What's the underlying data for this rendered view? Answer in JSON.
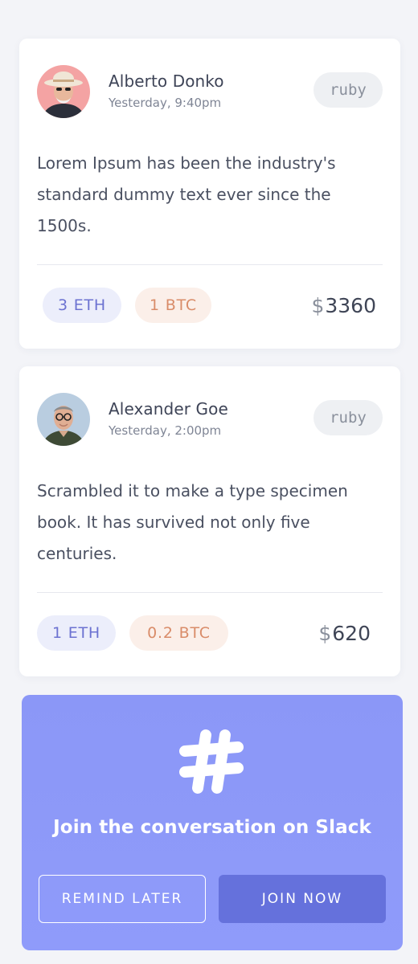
{
  "posts": [
    {
      "author": "Alberto Donko",
      "time": "Yesterday, 9:40pm",
      "tag": "ruby",
      "text": "Lorem Ipsum has been the industry's standard dummy text ever since the 1500s.",
      "eth": "3 ETH",
      "btc": "1 BTC",
      "currency": "$",
      "amount": "3360"
    },
    {
      "author": "Alexander Goe",
      "time": "Yesterday, 2:00pm",
      "tag": "ruby",
      "text": "Scrambled it to make a type specimen book. It has survived not only five centuries.",
      "eth": "1 ETH",
      "btc": "0.2 BTC",
      "currency": "$",
      "amount": "620"
    }
  ],
  "slack": {
    "icon": "slack-hash-icon",
    "title": "Join the conversation on Slack",
    "remind_label": "REMIND LATER",
    "join_label": "JOIN NOW"
  },
  "colors": {
    "background": "#f3f4f8",
    "card": "#ffffff",
    "eth": "#6c72d1",
    "btc": "#d98c69",
    "slack_bg": "#8b97f7",
    "join_button": "#6571dc"
  }
}
